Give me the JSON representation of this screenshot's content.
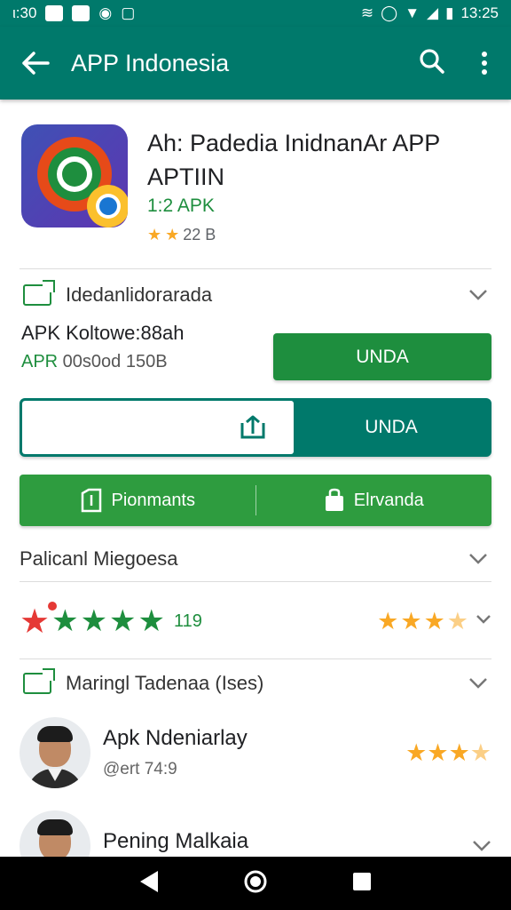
{
  "status_bar": {
    "time_left": "ι:30",
    "time_right": "13:25"
  },
  "app_bar": {
    "title": "APP Indonesia"
  },
  "app": {
    "name": "Ah: Padedia InidnanAr APP APTIIN",
    "version": "1:2 APK",
    "rating_text": "22 B"
  },
  "section1": {
    "title": "Idedanlidorarada"
  },
  "apk_info": {
    "line1": "APK Koltowe:88ah",
    "line2_prefix": "APR",
    "line2_rest": " 00s0od 150B"
  },
  "buttons": {
    "primary_label": "UNDA",
    "split_label": "UNDA",
    "bar_left_label": "Pionmants",
    "bar_right_label": "Elrvanda"
  },
  "section2": {
    "title": "Palicanl Miegoesa"
  },
  "rating_row": {
    "count": "119",
    "right_stars": 3.5
  },
  "section3": {
    "title": "Maringl Tadenaa  (Ises)"
  },
  "reviews": [
    {
      "name": "Apk Ndeniarlay",
      "sub": "@ert 74:9",
      "stars": 3.5
    },
    {
      "name": "Pening Malkaia",
      "sub": ""
    }
  ],
  "colors": {
    "teal": "#00796b",
    "green": "#1e8e3e",
    "star": "#f9a825",
    "red": "#e53935"
  }
}
